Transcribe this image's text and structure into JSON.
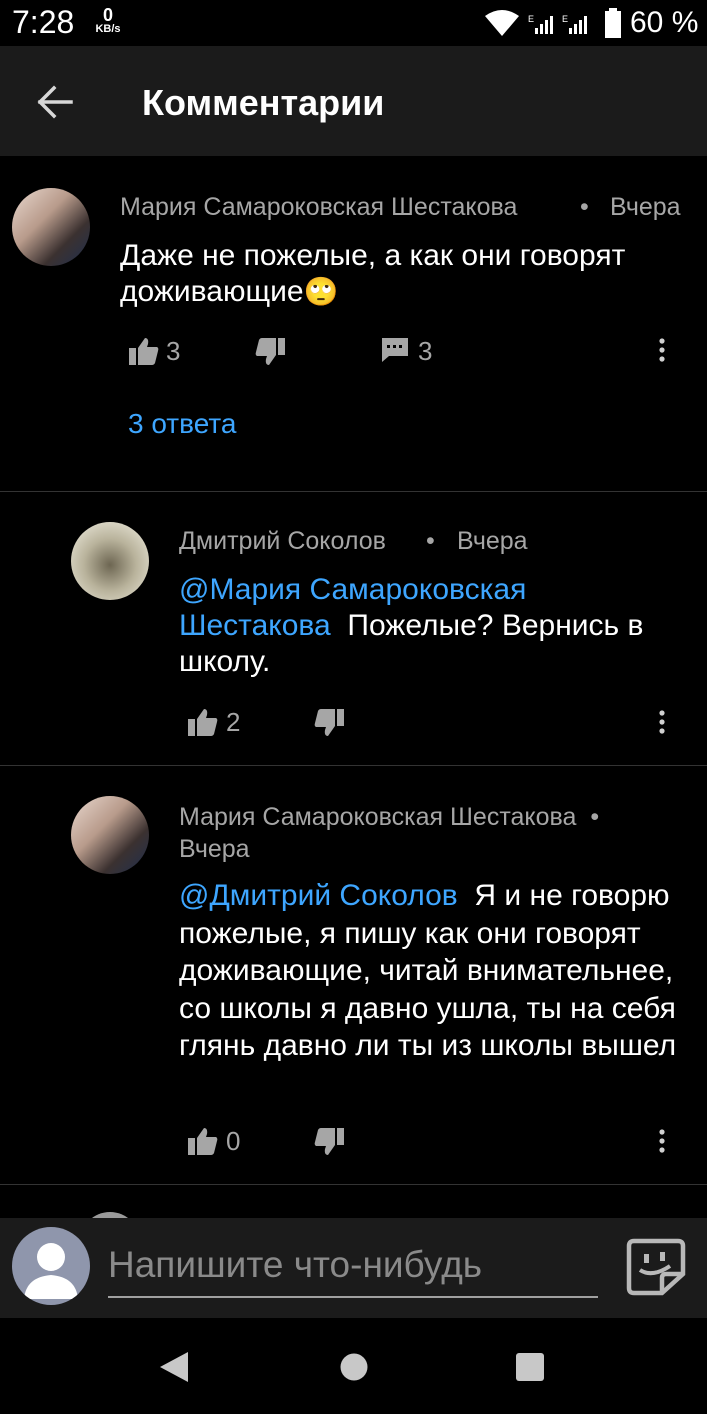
{
  "status_bar": {
    "time": "7:28",
    "net_speed_value": "0",
    "net_speed_unit": "KB/s",
    "battery": "60 %"
  },
  "header": {
    "title": "Комментарии"
  },
  "comments": [
    {
      "author": "Мария Самароковская Шестакова",
      "time": "Вчера",
      "text": "Даже не пожелые, а как они говорят доживающие",
      "emoji": "🙄",
      "likes": "3",
      "replies_count": "3",
      "replies_link": "3 ответа"
    },
    {
      "author": "Дмитрий Соколов",
      "time": "Вчера",
      "mention": "@Мария Самароковская Шестакова",
      "text": "Пожелые? Вернись в школу.",
      "likes": "2"
    },
    {
      "author": "Мария Самароковская Шестакова",
      "time": "Вчера",
      "mention": "@Дмитрий Соколов",
      "text": "Я и не говорю пожелые, я пишу как они говорят доживающие, читай внимательнее, со школы я давно ушла, ты на себя глянь давно ли ты из школы вышел",
      "likes": "0"
    }
  ],
  "composer": {
    "placeholder": "Напишите что-нибудь"
  },
  "colors": {
    "background": "#000000",
    "bar": "#1b1b1b",
    "link": "#3ea6ff",
    "secondary_text": "#a6a6a6"
  },
  "icons": [
    "back-arrow-icon",
    "thumb-up-icon",
    "thumb-down-icon",
    "reply-comment-icon",
    "more-vert-icon",
    "sticker-icon",
    "user-placeholder-icon",
    "nav-back-icon",
    "nav-home-icon",
    "nav-recents-icon"
  ]
}
